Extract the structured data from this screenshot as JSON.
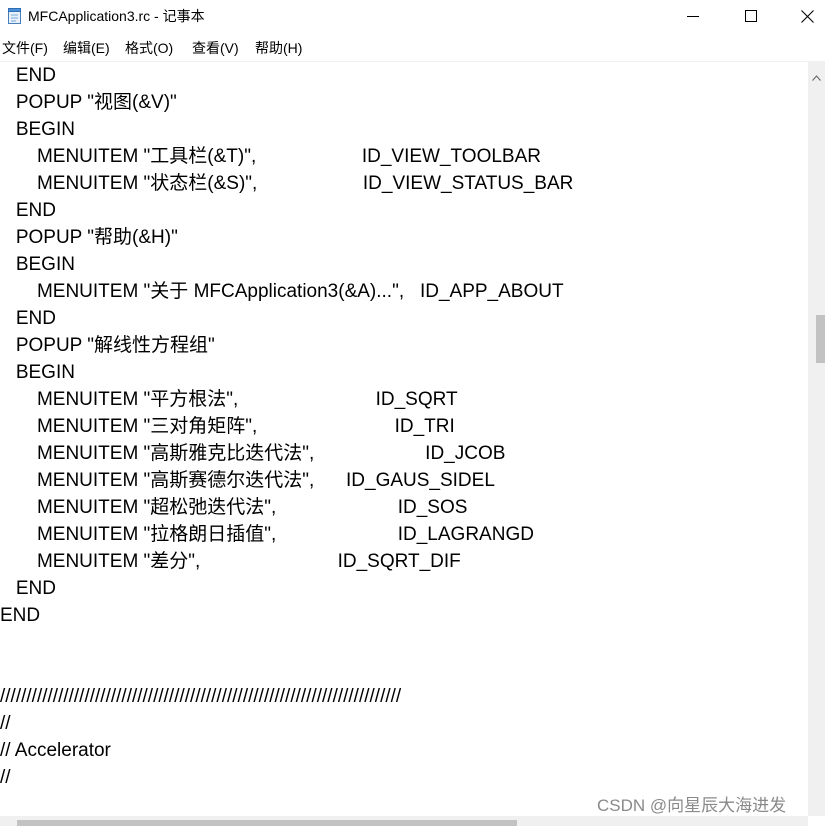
{
  "window": {
    "title": "MFCApplication3.rc - 记事本",
    "app_icon": "notepad-icon"
  },
  "controls": {
    "minimize_icon": "minimize-icon",
    "maximize_icon": "maximize-icon",
    "close_icon": "close-icon"
  },
  "menu": [
    {
      "label": "文件(F)"
    },
    {
      "label": "编辑(E)"
    },
    {
      "label": "格式(O)"
    },
    {
      "label": "查看(V)"
    },
    {
      "label": "帮助(H)"
    }
  ],
  "editor": {
    "lines": [
      {
        "text": "   END"
      },
      {
        "text": "   POPUP \"视图(&V)\""
      },
      {
        "text": "   BEGIN"
      },
      {
        "text": "       MENUITEM \"工具栏(&T)\",                    ID_VIEW_TOOLBAR"
      },
      {
        "text": "       MENUITEM \"状态栏(&S)\",                    ID_VIEW_STATUS_BAR"
      },
      {
        "text": "   END"
      },
      {
        "text": "   POPUP \"帮助(&H)\""
      },
      {
        "text": "   BEGIN"
      },
      {
        "text": "       MENUITEM \"关于 MFCApplication3(&A)...\",   ID_APP_ABOUT"
      },
      {
        "text": "   END"
      },
      {
        "text": "   POPUP \"解线性方程组\""
      },
      {
        "text": "   BEGIN"
      },
      {
        "text": "       MENUITEM \"平方根法\",                          ID_SQRT"
      },
      {
        "text": "       MENUITEM \"三对角矩阵\",                          ID_TRI"
      },
      {
        "text": "       MENUITEM \"高斯雅克比迭代法\",                     ID_JCOB"
      },
      {
        "text": "       MENUITEM \"高斯赛德尔迭代法\",      ID_GAUS_SIDEL"
      },
      {
        "text": "       MENUITEM \"超松弛迭代法\",                       ID_SOS"
      },
      {
        "text": "       MENUITEM \"拉格朗日插值\",                       ID_LAGRANGD"
      },
      {
        "text": "       MENUITEM \"差分\",                          ID_SQRT_DIF"
      },
      {
        "text": "   END"
      },
      {
        "text": "END"
      },
      {
        "text": ""
      },
      {
        "text": ""
      },
      {
        "text": "////////////////////////////////////////////////////////////////////////////"
      },
      {
        "text": "//"
      },
      {
        "text": "// Accelerator"
      },
      {
        "text": "//"
      }
    ]
  },
  "watermark": "CSDN @向星辰大海进发"
}
